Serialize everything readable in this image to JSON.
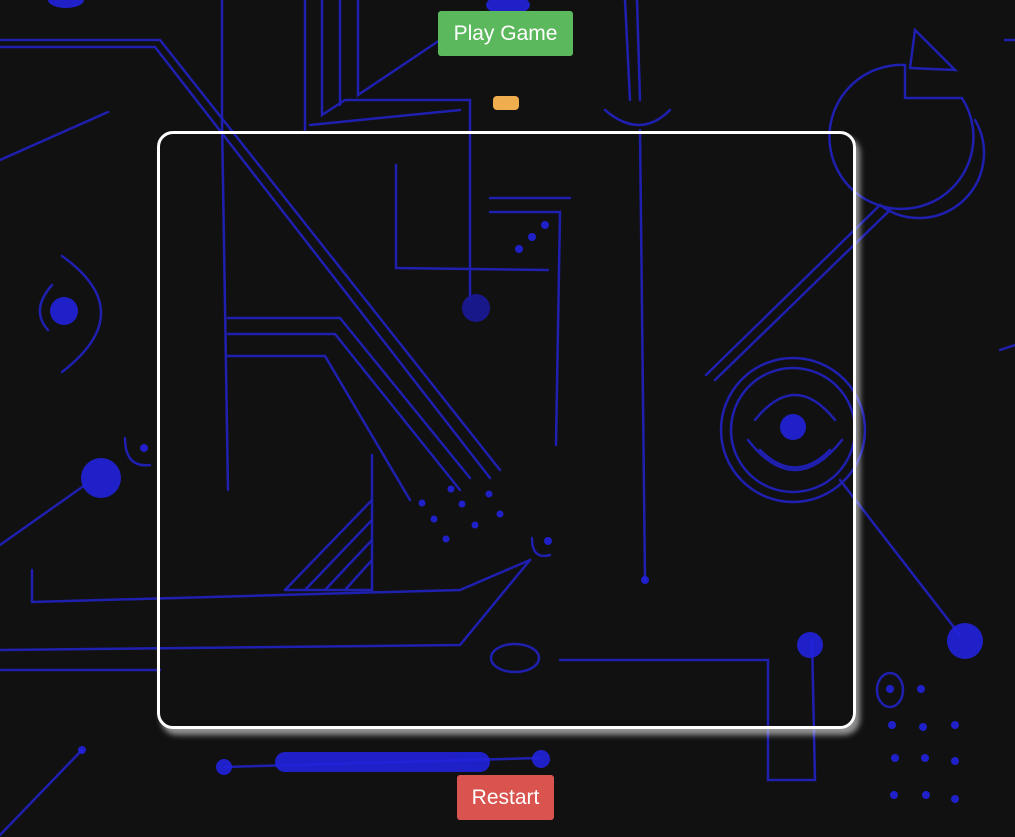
{
  "controls": {
    "play_label": "Play Game",
    "restart_label": "Restart"
  },
  "hud": {
    "score_text": ""
  },
  "theme": {
    "background": "#111111",
    "circuit_color": "#2222cc",
    "play_color": "#5cb85c",
    "restart_color": "#d9534f",
    "score_color": "#f0ad4e",
    "board_border": "#ffffff"
  },
  "icons": [
    "circuit-background-art"
  ]
}
